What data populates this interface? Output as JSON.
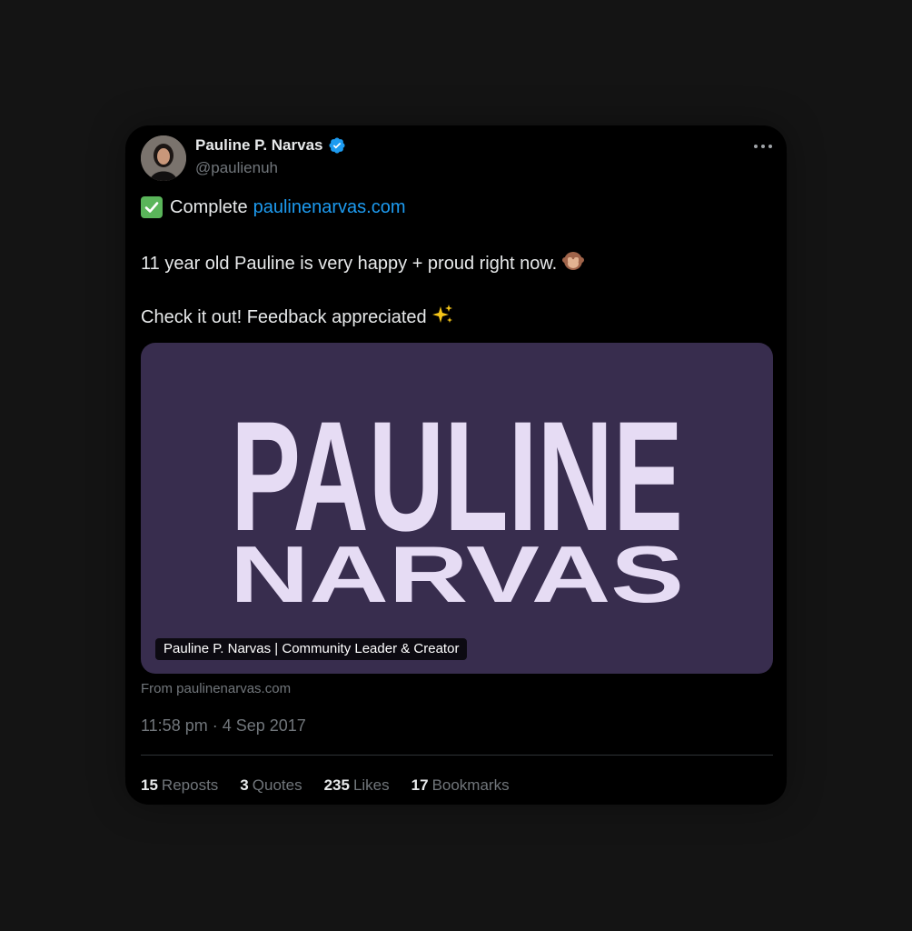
{
  "tweet": {
    "author": {
      "name": "Pauline P. Narvas",
      "handle": "@paulienuh",
      "verified": true
    },
    "text": {
      "line1_check": "✅",
      "line1_prefix": "Complete",
      "line1_link": "paulinenarvas.com",
      "line2": "11 year old Pauline is very happy + proud right now.",
      "line2_emoji": "🙈",
      "line3": "Check it out! Feedback appreciated",
      "line3_emoji": "✨"
    },
    "media": {
      "logo_line1": "PAULINE",
      "logo_line2": "NARVAS",
      "caption": "Pauline P. Narvas | Community Leader & Creator",
      "source": "From paulinenarvas.com",
      "background_color": "#382d4e",
      "logo_color": "#e6dcf4"
    },
    "timestamp": "11:58 pm · 4 Sep 2017",
    "stats": [
      {
        "count": "15",
        "label": "Reposts"
      },
      {
        "count": "3",
        "label": "Quotes"
      },
      {
        "count": "235",
        "label": "Likes"
      },
      {
        "count": "17",
        "label": "Bookmarks"
      }
    ],
    "colors": {
      "link": "#1d9bf0",
      "verified": "#1d9bf0",
      "muted": "#71767b",
      "text": "#e7e9ea"
    }
  }
}
